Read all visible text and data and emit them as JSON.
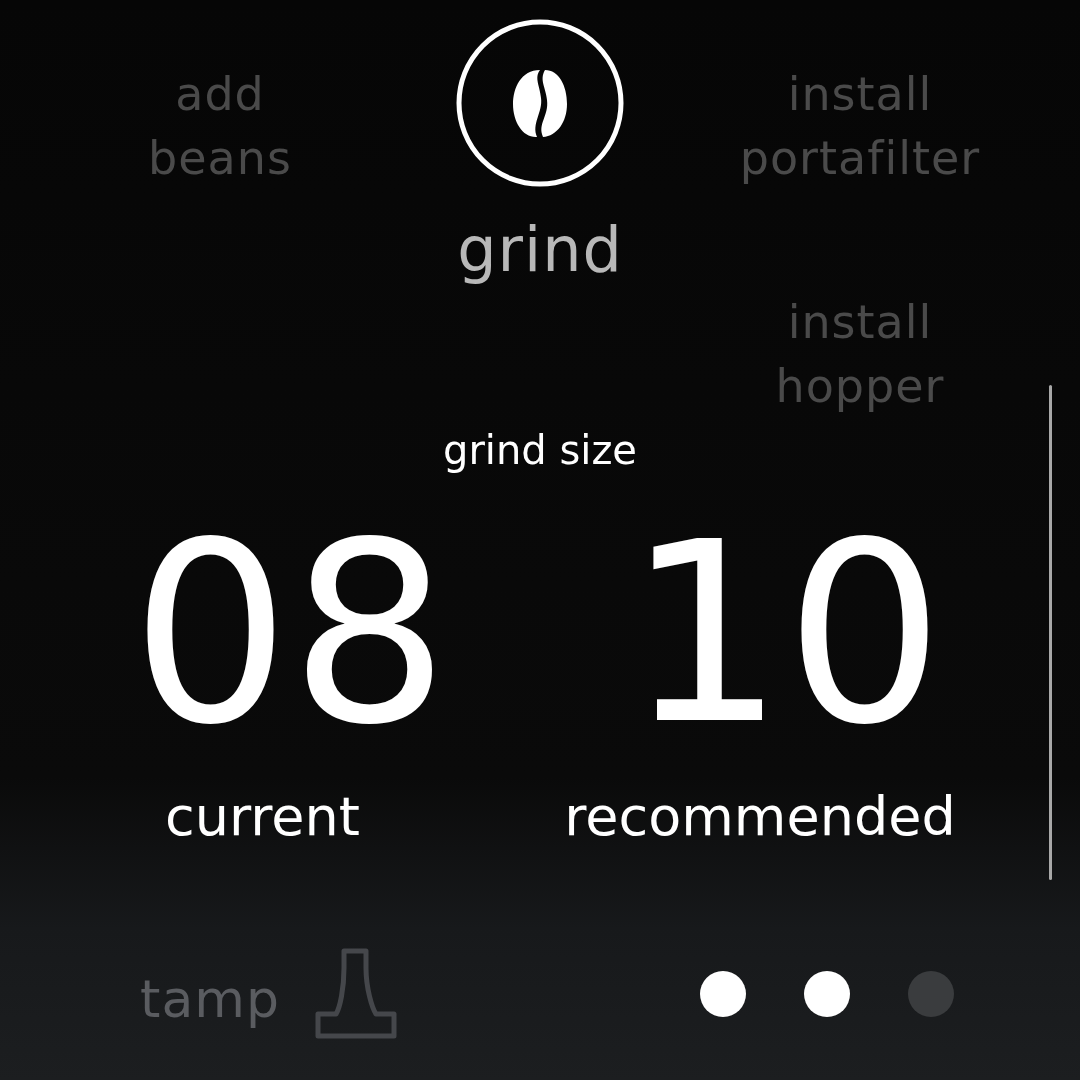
{
  "steps": [
    {
      "label": "add beans",
      "selected": false
    },
    {
      "label": "grind",
      "selected": true
    },
    {
      "label": "install portafilter",
      "selected": false
    },
    {
      "label": "install hopper",
      "selected": false
    },
    {
      "label": "tamp",
      "selected": false
    }
  ],
  "grind_size": {
    "title": "grind size",
    "displays": [
      {
        "value": "08",
        "label": "current"
      },
      {
        "value": "10",
        "label": "recommended"
      }
    ]
  },
  "page_dots": [
    {
      "filled": true
    },
    {
      "filled": true
    },
    {
      "filled": false
    }
  ]
}
